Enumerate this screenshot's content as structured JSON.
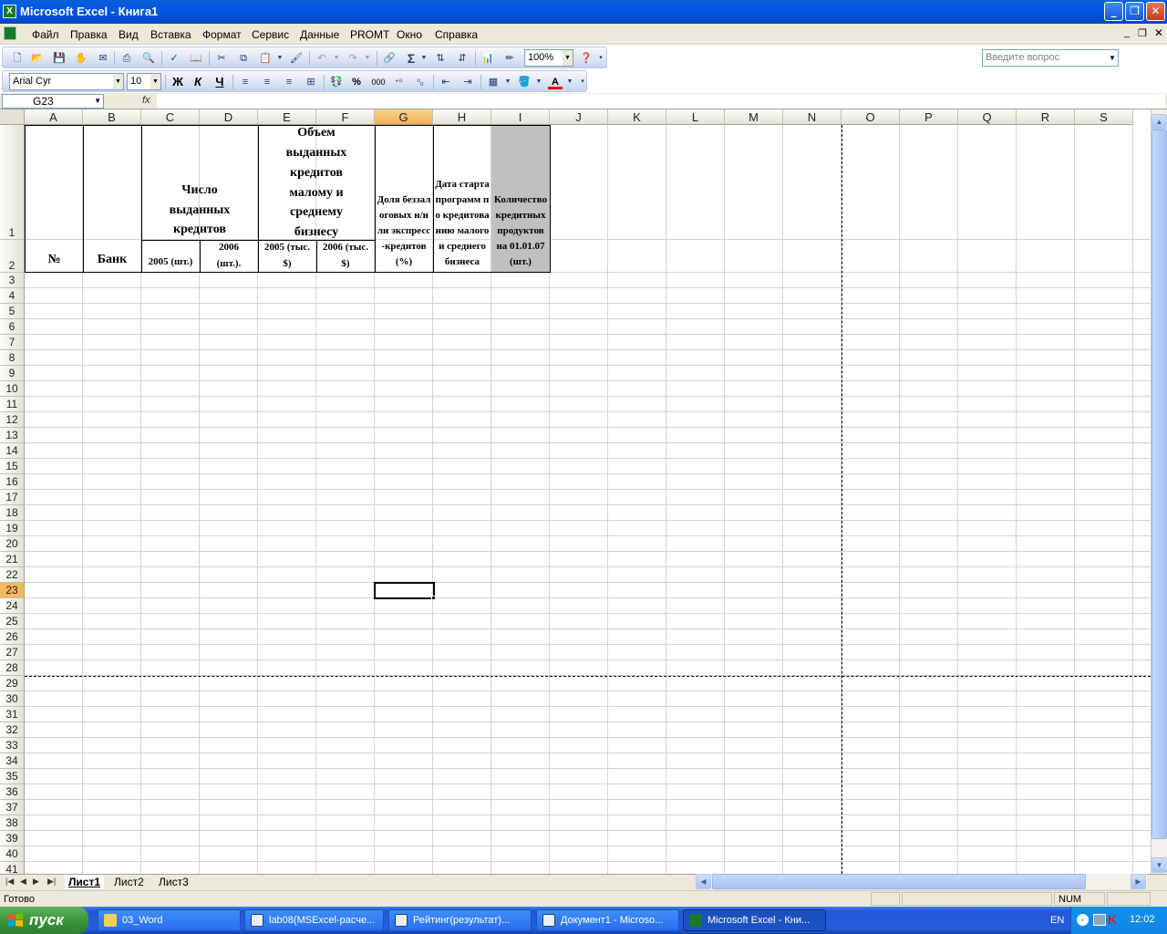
{
  "window": {
    "title": "Microsoft Excel - Книга1",
    "app_icon": "excel-icon"
  },
  "menu": {
    "items": [
      "Файл",
      "Правка",
      "Вид",
      "Вставка",
      "Формат",
      "Сервис",
      "Данные",
      "PROMT",
      "Окно",
      "Справка"
    ],
    "help_placeholder": "Введите вопрос"
  },
  "toolbar": {
    "zoom": "100%",
    "font_name": "Arial Cyr",
    "font_size": "10",
    "bold": "Ж",
    "italic": "К",
    "underline": "Ч",
    "sigma": "Σ",
    "percent": "%",
    "thousands": "000"
  },
  "formula_bar": {
    "name_box": "G23",
    "fx": "fx",
    "formula": ""
  },
  "columns": [
    "A",
    "B",
    "C",
    "D",
    "E",
    "F",
    "G",
    "H",
    "I",
    "J",
    "K",
    "L",
    "M",
    "N",
    "O",
    "P",
    "Q",
    "R",
    "S"
  ],
  "selected_column": "G",
  "selected_row": "23",
  "rows": [
    "1",
    "2",
    "3",
    "4",
    "5",
    "6",
    "7",
    "8",
    "9",
    "10",
    "11",
    "12",
    "13",
    "14",
    "15",
    "16",
    "17",
    "18",
    "19",
    "20",
    "21",
    "22",
    "23",
    "24",
    "25",
    "26",
    "27",
    "28",
    "29",
    "30",
    "31",
    "32",
    "33",
    "34",
    "35",
    "36",
    "37",
    "38",
    "39",
    "40",
    "41"
  ],
  "table": {
    "num": "№",
    "bank": "Банк",
    "credits_count": "Число выданных кредитов",
    "c2005": "2005 (шт.)",
    "d2006": "2006 (шт.).",
    "volume": "Объем выданных кредитов малому и среднему бизнесу",
    "e2005": "2005 (тыс. $)",
    "f2006": "2006 (тыс. $)",
    "g_share": "Доля беззалоговых н/или экспресс-кредитов (%)",
    "h_date": "Дата старта программ по кредитованию малого и среднего бизнеса",
    "i_count": "Количество кредитных продуктов на 01.01.07 (шт.)",
    "highlight_color": "#c0c0c0"
  },
  "sheets": {
    "tabs": [
      "Лист1",
      "Лист2",
      "Лист3"
    ],
    "active": "Лист1"
  },
  "status": {
    "left": "Готово",
    "num": "NUM"
  },
  "taskbar": {
    "start": "пуск",
    "tasks": [
      "03_Word",
      "lab08(MSExcel-расче...",
      "Рейтинг(результат)...",
      "Документ1 - Microso...",
      "Microsoft Excel - Кни..."
    ],
    "lang": "EN",
    "clock": "12:02"
  }
}
